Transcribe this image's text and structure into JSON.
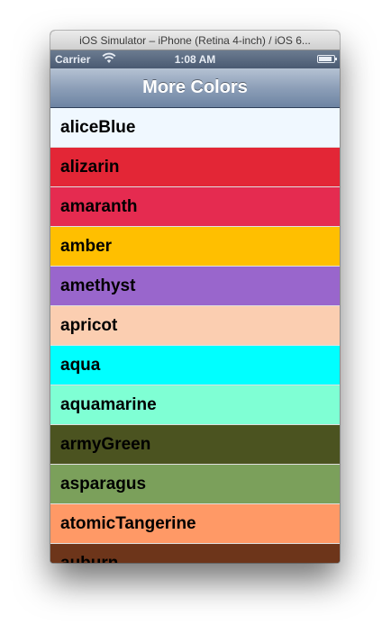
{
  "window": {
    "title": "iOS Simulator – iPhone (Retina 4-inch) / iOS 6..."
  },
  "status_bar": {
    "carrier": "Carrier",
    "time": "1:08 AM",
    "battery_level": 0.9
  },
  "nav_bar": {
    "title": "More Colors"
  },
  "colors": [
    {
      "name": "aliceBlue",
      "hex": "#F0F8FF"
    },
    {
      "name": "alizarin",
      "hex": "#E32636"
    },
    {
      "name": "amaranth",
      "hex": "#E52B50"
    },
    {
      "name": "amber",
      "hex": "#FFBF00"
    },
    {
      "name": "amethyst",
      "hex": "#9966CC"
    },
    {
      "name": "apricot",
      "hex": "#FBCEB1"
    },
    {
      "name": "aqua",
      "hex": "#00FFFF"
    },
    {
      "name": "aquamarine",
      "hex": "#7FFFD4"
    },
    {
      "name": "armyGreen",
      "hex": "#4B5320"
    },
    {
      "name": "asparagus",
      "hex": "#7BA05B"
    },
    {
      "name": "atomicTangerine",
      "hex": "#FF9966"
    },
    {
      "name": "auburn",
      "hex": "#6D351A"
    }
  ]
}
